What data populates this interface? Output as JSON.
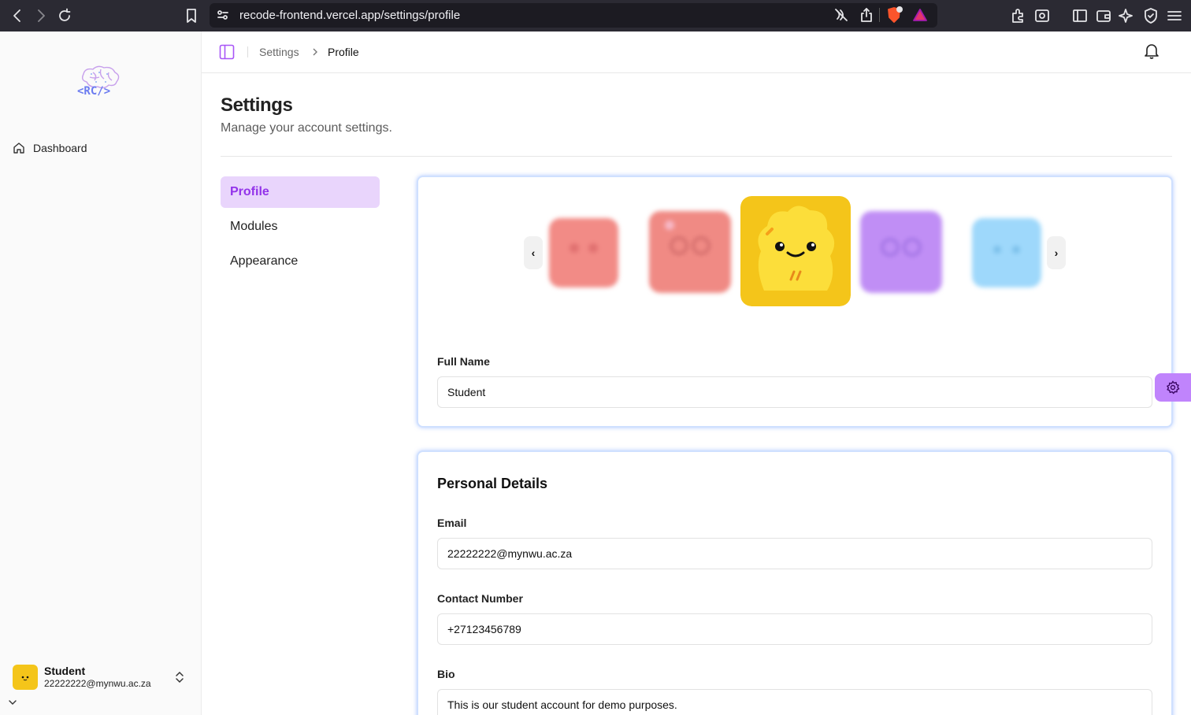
{
  "browser": {
    "url": "recode-frontend.vercel.app/settings/profile"
  },
  "sidebar": {
    "logo_text": "<RC/>",
    "nav": [
      {
        "label": "Dashboard",
        "icon": "home-icon"
      }
    ],
    "user": {
      "name": "Student",
      "email": "22222222@mynwu.ac.za"
    }
  },
  "topbar": {
    "breadcrumb": [
      "Settings",
      "Profile"
    ]
  },
  "header": {
    "title": "Settings",
    "subtitle": "Manage your account settings."
  },
  "settings_nav": {
    "items": [
      {
        "label": "Profile",
        "active": true
      },
      {
        "label": "Modules",
        "active": false
      },
      {
        "label": "Appearance",
        "active": false
      }
    ]
  },
  "avatar_carousel": {
    "prev_label": "‹",
    "next_label": "›",
    "avatars": [
      {
        "color": "#f28b86",
        "selected": false
      },
      {
        "color": "#f08a84",
        "selected": false
      },
      {
        "color": "#fbd93a",
        "selected": true
      },
      {
        "color": "#c08ef5",
        "selected": false
      },
      {
        "color": "#9ed8fb",
        "selected": false
      }
    ]
  },
  "profile_form": {
    "full_name_label": "Full Name",
    "full_name_value": "Student"
  },
  "personal_details": {
    "title": "Personal Details",
    "email_label": "Email",
    "email_value": "22222222@mynwu.ac.za",
    "contact_label": "Contact Number",
    "contact_value": "+27123456789",
    "bio_label": "Bio",
    "bio_value": "This is our student account for demo purposes."
  },
  "colors": {
    "accent": "#9333ea",
    "accent_bg": "#e9d5fc",
    "selected_avatar": "#f4c51a"
  }
}
